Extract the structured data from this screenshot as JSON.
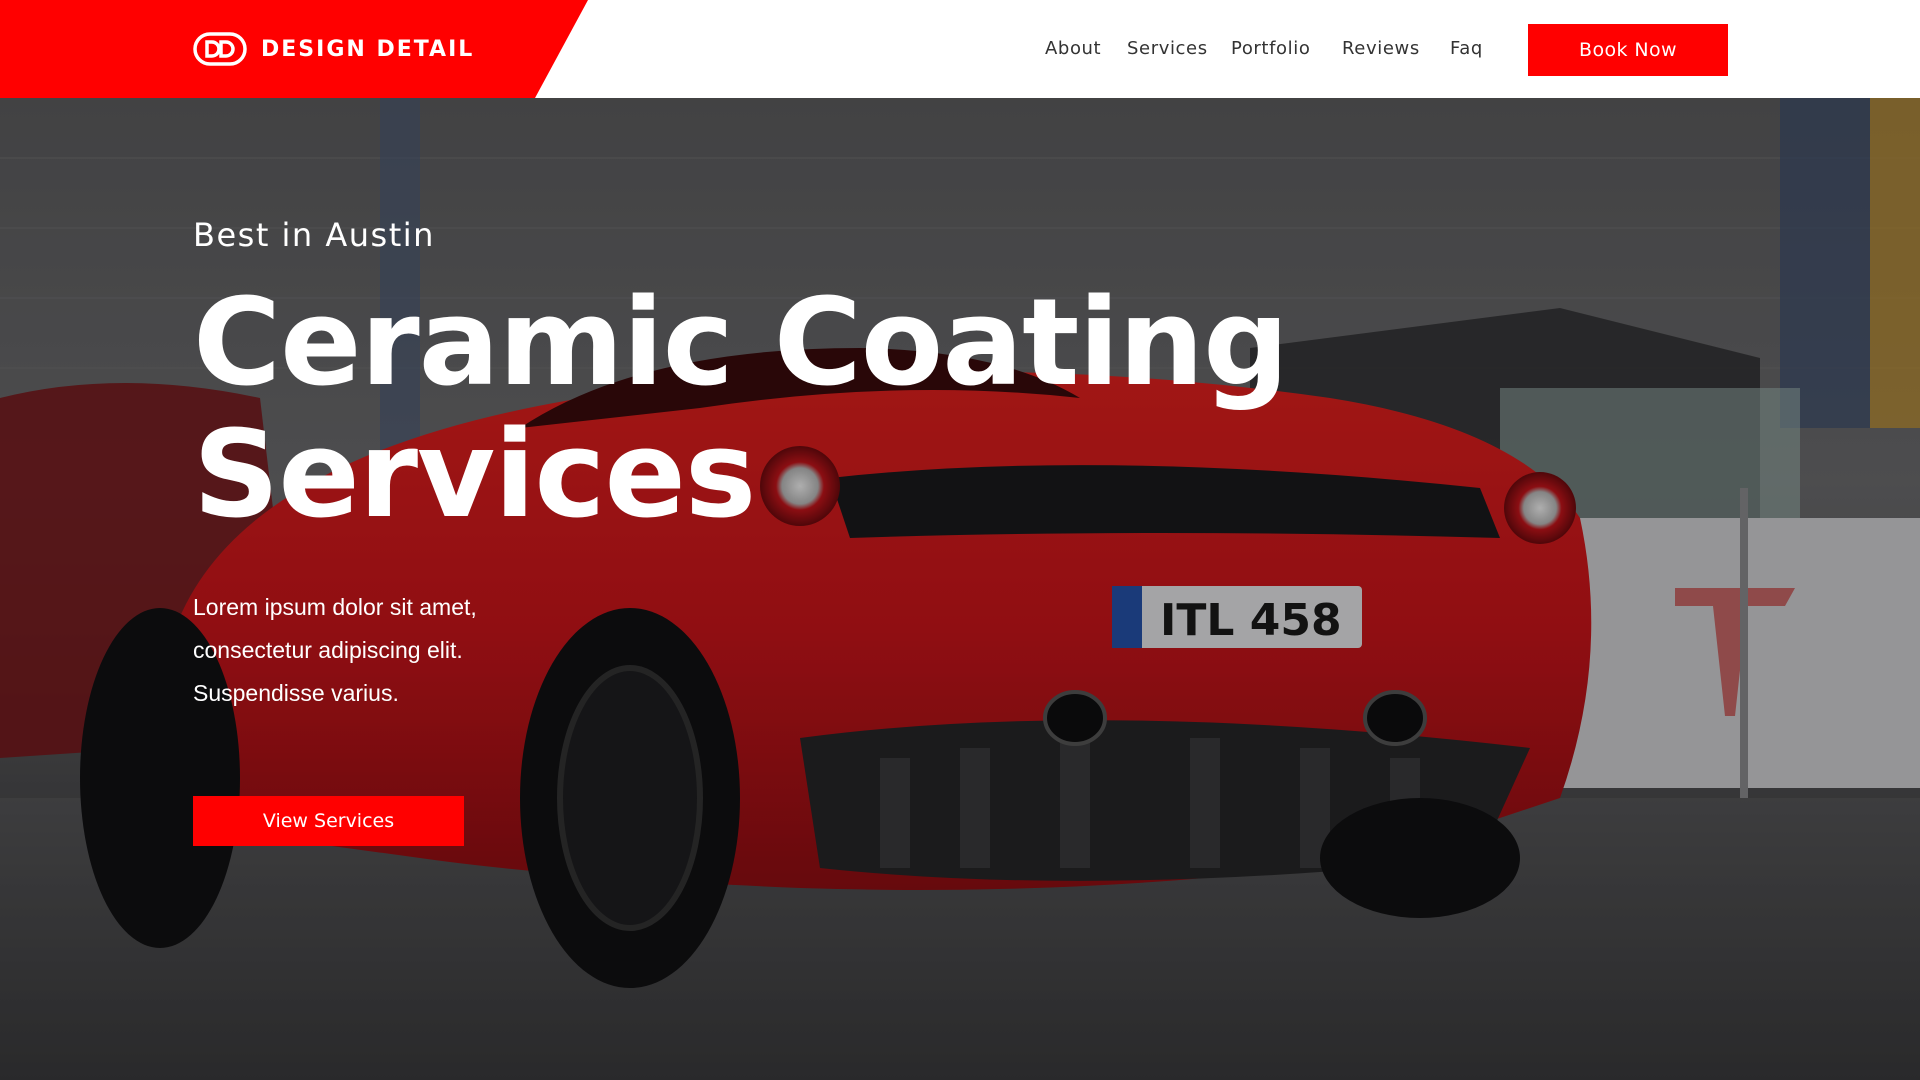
{
  "brand": {
    "name": "DESIGN DETAIL",
    "logo_icon": "dd-monogram-icon",
    "color": "#ff0000"
  },
  "nav": {
    "items": [
      {
        "label": "About"
      },
      {
        "label": "Services"
      },
      {
        "label": "Portfolio"
      },
      {
        "label": "Reviews"
      },
      {
        "label": "Faq"
      }
    ],
    "cta_label": "Book Now"
  },
  "hero": {
    "eyebrow": "Best in Austin",
    "headline": "Ceramic Coating Services",
    "body": "Lorem ipsum dolor sit amet, consectetur adipiscing elit. Suspendisse varius.",
    "cta_label": "View Services",
    "background": "red-sports-car-in-garage-photo",
    "plate": "ITL 458"
  },
  "colors": {
    "accent": "#ff0000",
    "header_bg": "#ffffff",
    "nav_text": "#333333",
    "hero_text": "#ffffff"
  }
}
